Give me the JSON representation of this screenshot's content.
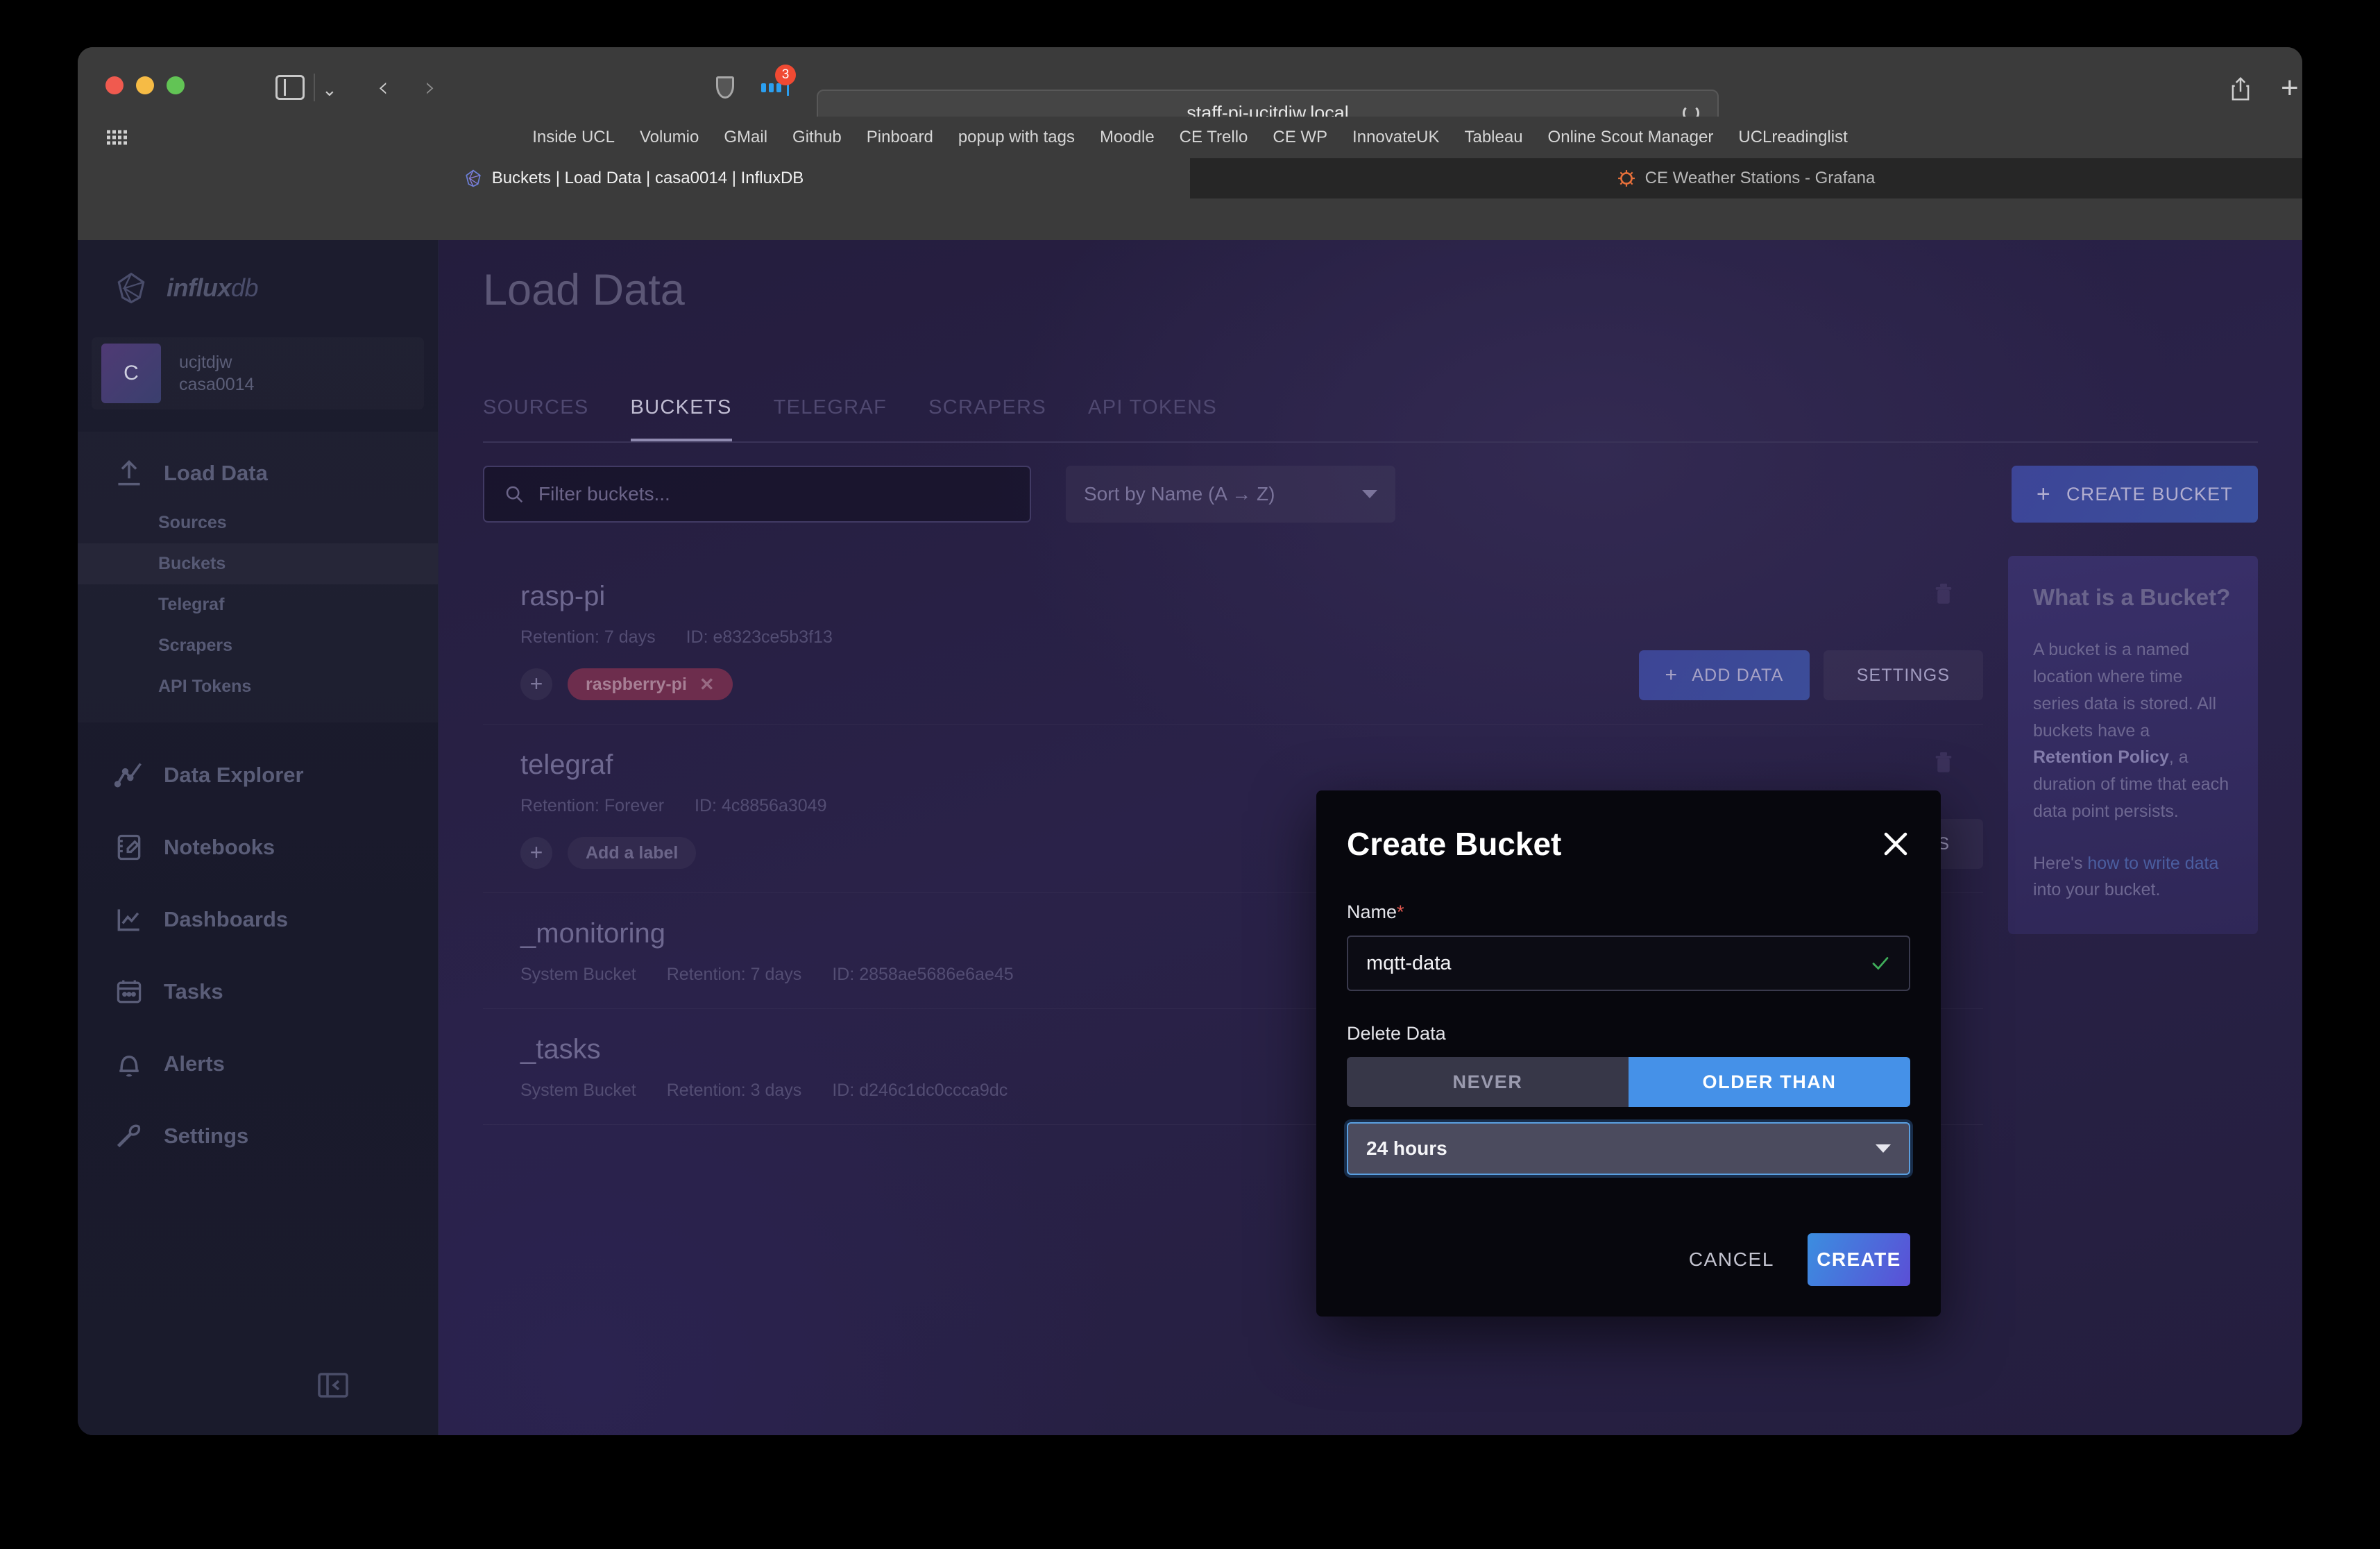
{
  "browser": {
    "url": "staff-pi-ucjtdjw.local",
    "extension_badge_count": "3",
    "bookmarks": [
      "Inside UCL",
      "Volumio",
      "GMail",
      "Github",
      "Pinboard",
      "popup with tags",
      "Moodle",
      "CE Trello",
      "CE WP",
      "InnovateUK",
      "Tableau",
      "Online Scout Manager",
      "UCLreadinglist"
    ],
    "tabs": [
      {
        "label": "Buckets | Load Data | casa0014 | InfluxDB",
        "active": true
      },
      {
        "label": "CE Weather Stations - Grafana",
        "active": false
      }
    ]
  },
  "sidebar": {
    "product": {
      "bold": "influx",
      "light": "db"
    },
    "org": {
      "avatar_letter": "C",
      "user": "ucjtdjw",
      "name": "casa0014"
    },
    "load_data": {
      "label": "Load Data",
      "children": [
        "Sources",
        "Buckets",
        "Telegraf",
        "Scrapers",
        "API Tokens"
      ],
      "active_child": "Buckets"
    },
    "nav": [
      "Data Explorer",
      "Notebooks",
      "Dashboards",
      "Tasks",
      "Alerts",
      "Settings"
    ]
  },
  "main": {
    "page_title": "Load Data",
    "tabs": [
      "SOURCES",
      "BUCKETS",
      "TELEGRAF",
      "SCRAPERS",
      "API TOKENS"
    ],
    "active_tab": "BUCKETS",
    "toolbar": {
      "filter_placeholder": "Filter buckets...",
      "sort_label": "Sort by Name (A → Z)",
      "create_bucket_label": "CREATE BUCKET"
    },
    "row_actions": {
      "add_data": "ADD DATA",
      "settings": "SETTINGS"
    },
    "buckets": [
      {
        "name": "rasp-pi",
        "system_bucket": "",
        "retention": "Retention: 7 days",
        "id": "ID: e8323ce5b3f13",
        "label": "raspberry-pi",
        "has_label_pill": true,
        "label_placeholder": "",
        "has_actions": true,
        "has_trash": true
      },
      {
        "name": "telegraf",
        "system_bucket": "",
        "retention": "Retention: Forever",
        "id": "ID: 4c8856a3049",
        "label": "",
        "has_label_pill": false,
        "label_placeholder": "Add a label",
        "has_actions": true,
        "has_trash": true
      },
      {
        "name": "_monitoring",
        "system_bucket": "System Bucket",
        "retention": "Retention: 7 days",
        "id": "ID: 2858ae5686e6ae45",
        "label": "",
        "has_label_pill": false,
        "label_placeholder": "",
        "has_actions": false,
        "has_trash": false
      },
      {
        "name": "_tasks",
        "system_bucket": "System Bucket",
        "retention": "Retention: 3 days",
        "id": "ID: d246c1dc0ccca9dc",
        "label": "",
        "has_label_pill": false,
        "label_placeholder": "",
        "has_actions": false,
        "has_trash": false
      }
    ],
    "info_panel": {
      "title": "What is a Bucket?",
      "para1_a": "A bucket is a named location where time series data is stored. All buckets have a ",
      "para1_bold": "Retention Policy",
      "para1_b": ", a duration of time that each data point persists.",
      "para2_a": "Here's ",
      "para2_link": "how to write data",
      "para2_b": " into your bucket."
    }
  },
  "modal": {
    "title": "Create Bucket",
    "name_label": "Name",
    "name_required_mark": "*",
    "name_value": "mqtt-data",
    "delete_data_label": "Delete Data",
    "toggle_never": "NEVER",
    "toggle_older_than": "OLDER THAN",
    "toggle_selected": "OLDER THAN",
    "retention_value": "24 hours",
    "cancel_label": "CANCEL",
    "create_label": "CREATE"
  },
  "colors": {
    "accent_blue": "#4591e8",
    "create_gradient_start": "#3b8ee0",
    "create_gradient_end": "#5b4fd6",
    "required_red": "#e85b52",
    "valid_green": "#3fae5a",
    "label_pill": "#6d2d4d"
  }
}
